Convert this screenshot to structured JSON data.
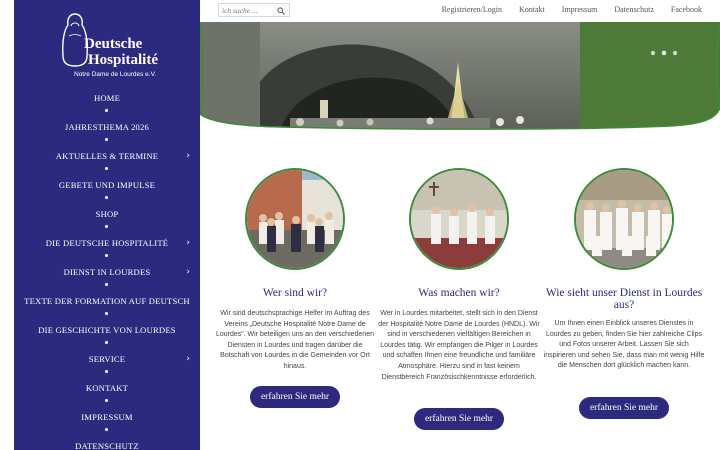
{
  "logo": {
    "line1": "Deutsche",
    "line2": "Hospitalité",
    "line3": "Notre Dame de Lourdes e.V."
  },
  "nav": [
    {
      "label": "HOME",
      "submenu": false
    },
    {
      "label": "JAHRESTHEMA 2026",
      "submenu": false
    },
    {
      "label": "AKTUELLES & TERMINE",
      "submenu": true
    },
    {
      "label": "GEBETE UND IMPULSE",
      "submenu": false
    },
    {
      "label": "SHOP",
      "submenu": false
    },
    {
      "label": "DIE DEUTSCHE HOSPITALITÉ",
      "submenu": true
    },
    {
      "label": "DIENST IN LOURDES",
      "submenu": true
    },
    {
      "label": "TEXTE DER FORMATION AUF DEUTSCH",
      "submenu": false
    },
    {
      "label": "DIE GESCHICHTE VON LOURDES",
      "submenu": false
    },
    {
      "label": "SERVICE",
      "submenu": true
    },
    {
      "label": "KONTAKT",
      "submenu": false
    },
    {
      "label": "IMPRESSUM",
      "submenu": false
    },
    {
      "label": "DATENSCHUTZ",
      "submenu": false
    }
  ],
  "search": {
    "placeholder": "ich suche ..."
  },
  "topnav": [
    "Registrieren/Login",
    "Kontakt",
    "Impressum",
    "Datenschutz",
    "Facebook"
  ],
  "colors": {
    "primary": "#2b2a7e",
    "accent_green": "#3f8a3a",
    "text": "#444444"
  },
  "columns": [
    {
      "title": "Wer sind wir?",
      "text": "Wir sind deutschsprachige Helfer im Auftrag des Vereins „Deutsche Hospitalité Notre Dame de Lourdes“. Wir beteiligen uns an den verschiedenen Diensten in Lourdes und tragen darüber die Botschaft von Lourdes in die Gemeinden vor Ort hinaus.",
      "button": "erfahren Sie mehr"
    },
    {
      "title": "Was machen wir?",
      "text": "Wer in Lourdes mitarbeitet, stellt sich in den Dienst der Hospitalité Notre Dame de Lourdes (HNDL). Wir sind in verschiedenen vielfältigen Bereichen in Lourdes tätig. Wir empfangen die Pilger in Lourdes und schaffen Ihnen eine freundliche und familiäre Atmosphäre. Hierzu sind in fast keinem Dienstbereich Französischkenntnisse erforderlich.",
      "button": "erfahren Sie mehr"
    },
    {
      "title": "Wie sieht unser Dienst in Lourdes aus?",
      "text": "Um Ihnen einen Einblick unseres Dienstes in Lourdes zu geben, finden Sie hier zahlreiche Clips und Fotos unserer Arbeit. Lassen Sie sich inspirieren und sehen Sie, dass man mit wenig Hilfe die Menschen dort glücklich machen kann.",
      "button": "erfahren Sie mehr"
    }
  ]
}
